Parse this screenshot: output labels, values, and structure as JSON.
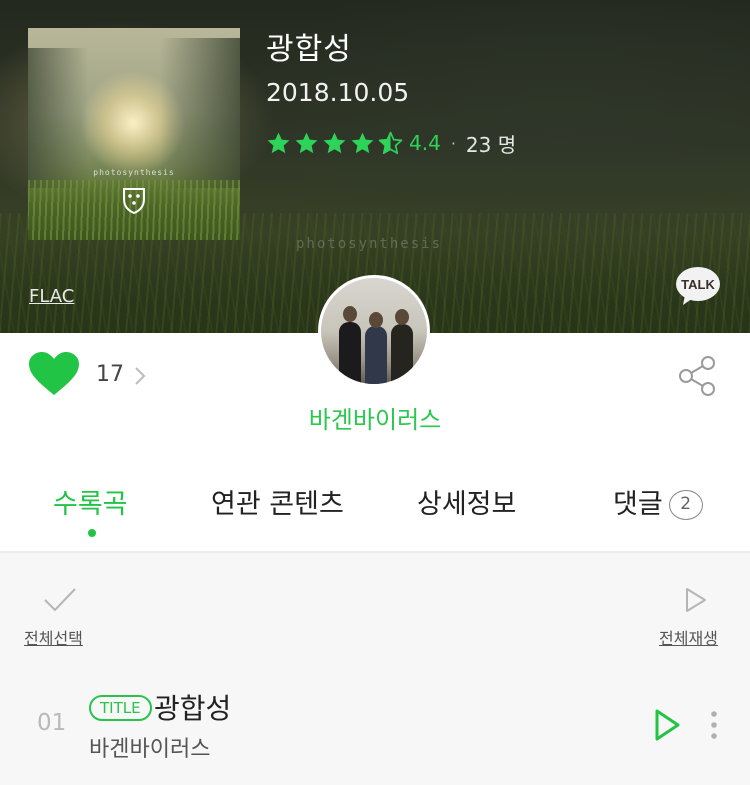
{
  "album": {
    "title": "광합성",
    "release_date": "2018.10.05",
    "rating": "4.4",
    "rating_fraction": 0.88,
    "rating_separator": "·",
    "rating_count": "23 명",
    "cover_text": "photosynthesis",
    "watermark": "photosynthesis",
    "format_link": "FLAC",
    "talk_button_label": "TALK"
  },
  "actions": {
    "like_count": "17",
    "icons": [
      "heart-icon",
      "chevron-right-icon",
      "share-icon"
    ]
  },
  "artist": {
    "name": "바겐바이러스"
  },
  "tabs": [
    {
      "label": "수록곡",
      "active": true
    },
    {
      "label": "연관 콘텐츠",
      "active": false
    },
    {
      "label": "상세정보",
      "active": false
    },
    {
      "label": "댓글",
      "badge": "2",
      "active": false
    }
  ],
  "toolbar": {
    "select_all_label": "전체선택",
    "play_all_label": "전체재생"
  },
  "tracks": [
    {
      "number": "01",
      "badge": "TITLE",
      "title": "광합성",
      "artist": "바겐바이러스"
    }
  ],
  "colors": {
    "accent_green": "#22c446",
    "star_green": "#2ed35a",
    "list_background": "#f7f7f7"
  }
}
